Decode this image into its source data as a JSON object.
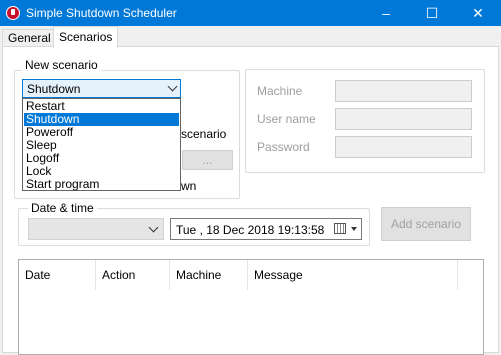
{
  "window": {
    "title": "Simple Shutdown Scheduler",
    "controls": {
      "minimize": "–",
      "maximize": "☐",
      "close": "✕"
    }
  },
  "tabs": [
    {
      "label": "General"
    },
    {
      "label": "Scenarios"
    }
  ],
  "new_scenario": {
    "group_label": "New scenario",
    "selected_action": "Shutdown",
    "options": [
      "Restart",
      "Shutdown",
      "Poweroff",
      "Sleep",
      "Logoff",
      "Lock",
      "Start program"
    ],
    "partial_texts": {
      "scenario": "scenario",
      "browse_button": "...",
      "down": "wn"
    }
  },
  "remote": {
    "machine_label": "Machine",
    "user_label": "User name",
    "password_label": "Password",
    "machine_value": "",
    "user_value": "",
    "password_value": ""
  },
  "datetime": {
    "group_label": "Date & time",
    "preset_value": "",
    "value": "Tue , 18 Dec 2018 19:13:58"
  },
  "add_button": "Add scenario",
  "list": {
    "columns": [
      "Date",
      "Action",
      "Machine",
      "Message"
    ]
  }
}
